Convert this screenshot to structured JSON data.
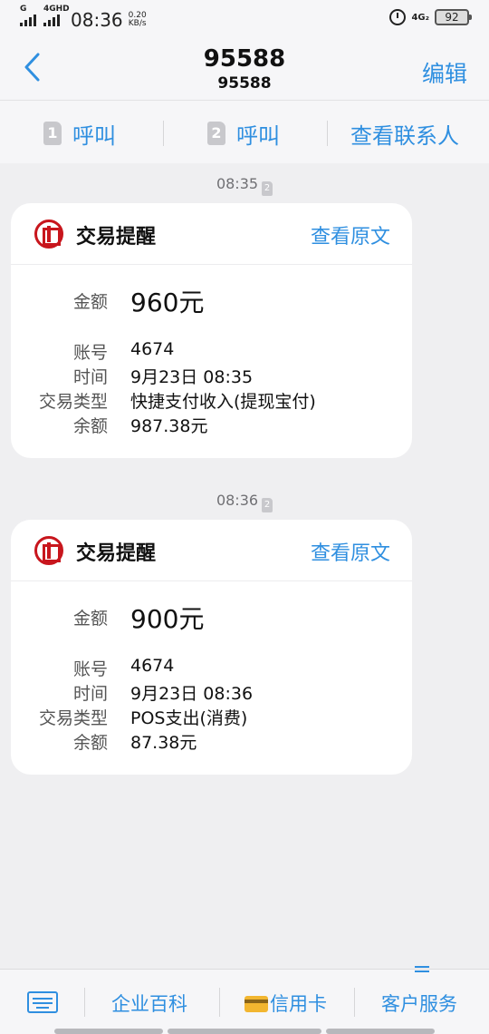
{
  "status_bar": {
    "signal_label": "G",
    "network_label": "4GHD",
    "time": "08:36",
    "speed_value": "0.20",
    "speed_unit": "KB/s",
    "net_right": "4G₂",
    "battery": "92"
  },
  "header": {
    "title": "95588",
    "subtitle": "95588",
    "edit_label": "编辑"
  },
  "actions": {
    "call1_sim": "1",
    "call1_label": "呼叫",
    "call2_sim": "2",
    "call2_label": "呼叫",
    "view_contact_label": "查看联系人"
  },
  "messages": [
    {
      "timestamp": "08:35",
      "sim": "2",
      "card_title": "交易提醒",
      "view_original": "查看原文",
      "amount_label": "金额",
      "amount": "960元",
      "account_label": "账号",
      "account": "4674",
      "time_label": "时间",
      "time": "9月23日 08:35",
      "type_label": "交易类型",
      "type": "快捷支付收入(提现宝付)",
      "balance_label": "余额",
      "balance": "987.38元"
    },
    {
      "timestamp": "08:36",
      "sim": "2",
      "card_title": "交易提醒",
      "view_original": "查看原文",
      "amount_label": "金额",
      "amount": "900元",
      "account_label": "账号",
      "account": "4674",
      "time_label": "时间",
      "time": "9月23日 08:36",
      "type_label": "交易类型",
      "type": "POS支出(消费)",
      "balance_label": "余额",
      "balance": "87.38元"
    }
  ],
  "bottom_bar": {
    "encyclopedia": "企业百科",
    "credit_card": "信用卡",
    "customer_service": "客户服务"
  },
  "colors": {
    "accent": "#2f8fe0",
    "bank_red": "#c8161d"
  }
}
